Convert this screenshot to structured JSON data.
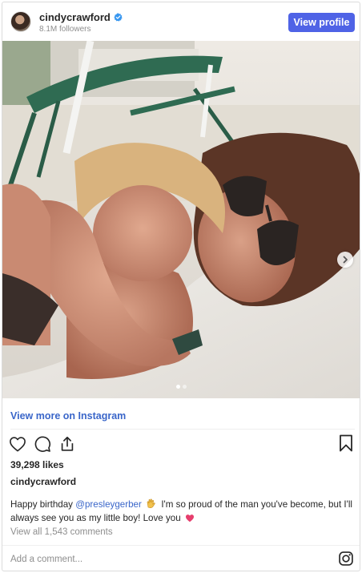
{
  "header": {
    "username": "cindycrawford",
    "followers": "8.1M followers",
    "view_profile_label": "View profile",
    "verified": true
  },
  "media": {
    "carousel_index": 1,
    "carousel_total": 2,
    "next_icon": "chevron-right-icon"
  },
  "view_more_label": "View more on Instagram",
  "actions": {
    "like_icon": "heart-icon",
    "comment_icon": "comment-icon",
    "share_icon": "share-icon",
    "save_icon": "bookmark-icon"
  },
  "likes": "39,298 likes",
  "caption": {
    "username": "cindycrawford",
    "prefix": "Happy birthday ",
    "mention": "@presleygerber",
    "text": " I'm so proud of the man you've become, but I'll always see you as my little boy! Love you ",
    "emoji_1": "clapping-hands-emoji",
    "emoji_2": "heart-emoji"
  },
  "view_all_comments": "View all 1,543 comments",
  "comment_placeholder": "Add a comment...",
  "colors": {
    "accent": "#4f63e6",
    "link": "#3a66c9",
    "muted": "#8e8e8e",
    "verified": "#3897f0",
    "heart": "#ed4956"
  }
}
